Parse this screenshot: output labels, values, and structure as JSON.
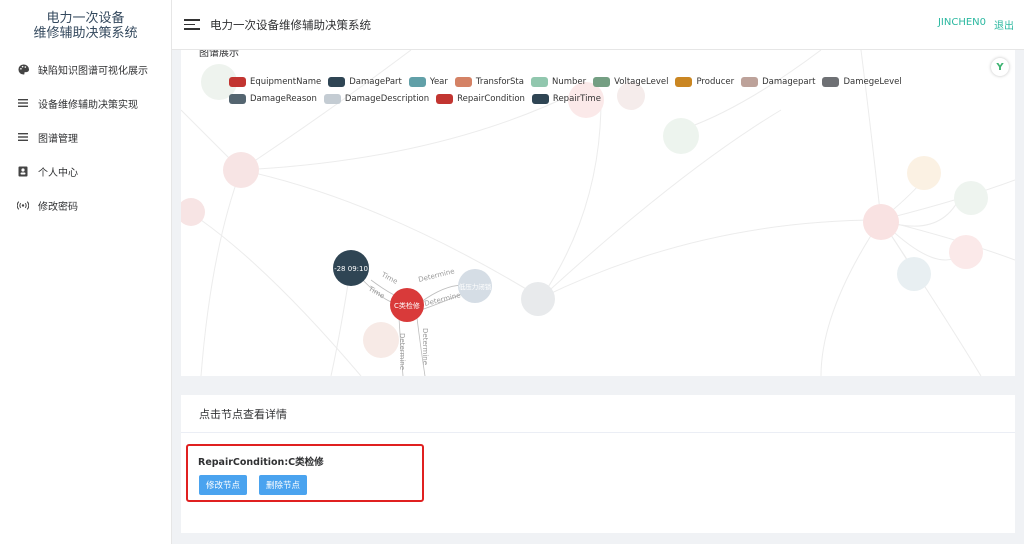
{
  "sidebar": {
    "brand_line1": "电力一次设备",
    "brand_line2": "维修辅助决策系统",
    "items": [
      {
        "label": "缺陷知识图谱可视化展示",
        "icon": "palette-icon"
      },
      {
        "label": "设备维修辅助决策实现",
        "icon": "list-icon"
      },
      {
        "label": "图谱管理",
        "icon": "list-icon"
      },
      {
        "label": "个人中心",
        "icon": "contact-icon"
      },
      {
        "label": "修改密码",
        "icon": "signal-icon"
      }
    ]
  },
  "header": {
    "title": "电力一次设备维修辅助决策系统",
    "username": "JINCHEN0",
    "logout": "退出"
  },
  "graph_card": {
    "title": "图谱展示",
    "legend": [
      {
        "label": "EquipmentName",
        "color": "#c23531"
      },
      {
        "label": "DamagePart",
        "color": "#2f4554"
      },
      {
        "label": "Year",
        "color": "#61a0a8"
      },
      {
        "label": "TransforSta",
        "color": "#d48265"
      },
      {
        "label": "Number",
        "color": "#91c7ae"
      },
      {
        "label": "VoltageLevel",
        "color": "#749f83"
      },
      {
        "label": "Producer",
        "color": "#ca8622"
      },
      {
        "label": "Damagepart",
        "color": "#bda29a"
      },
      {
        "label": "DamegeLevel",
        "color": "#6e7074"
      },
      {
        "label": "DamageReason",
        "color": "#546570"
      },
      {
        "label": "DamageDescription",
        "color": "#c4ccd3"
      },
      {
        "label": "RepairCondition",
        "color": "#c23531"
      },
      {
        "label": "RepairTime",
        "color": "#2f4554"
      }
    ],
    "nodes": {
      "time_node": "-28 09:10",
      "repair_node": "C类检修",
      "desc_node": "低压力闭锁"
    },
    "edges": {
      "time1": "Time",
      "time2": "Time",
      "determine1": "Determine",
      "determine2": "Determine",
      "determine3": "Determine",
      "determine4": "Determine"
    },
    "badge": "Y"
  },
  "detail_card": {
    "title": "点击节点查看详情",
    "node_label": "RepairCondition:C类检修",
    "edit_button": "修改节点",
    "delete_button": "删除节点"
  }
}
